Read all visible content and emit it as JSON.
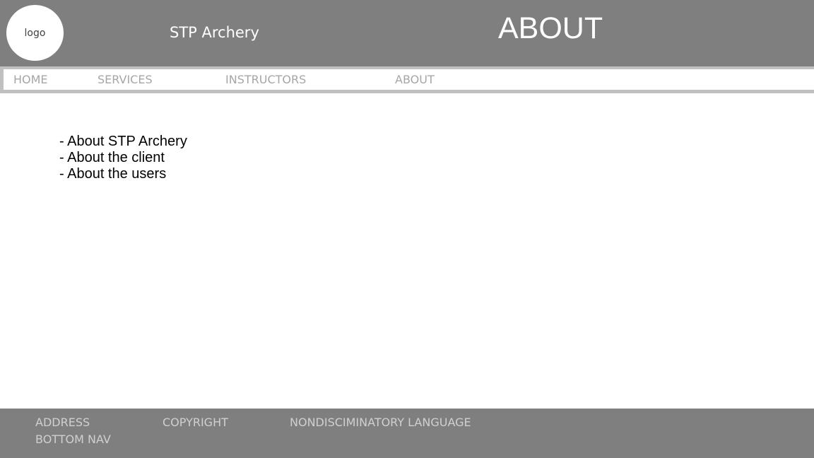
{
  "header": {
    "logo_label": "logo",
    "site_name": "STP Archery",
    "page_heading": "ABOUT"
  },
  "nav": {
    "items": [
      {
        "label": "HOME"
      },
      {
        "label": "SERVICES"
      },
      {
        "label": "INSTRUCTORS"
      },
      {
        "label": "ABOUT"
      }
    ]
  },
  "content": {
    "items": [
      {
        "label": "- About STP Archery"
      },
      {
        "label": "- About the client"
      },
      {
        "label": "- About the users"
      }
    ]
  },
  "footer": {
    "address": "ADDRESS",
    "copyright": "COPYRIGHT",
    "nondiscriminatory": "NONDISCIMINATORY LANGUAGE",
    "bottom_nav": "BOTTOM NAV"
  },
  "colors": {
    "header_bg": "#7f7f7f",
    "nav_border": "#c0c0c0",
    "nav_text": "#a6a6a6",
    "footer_text": "#d0d0d0"
  }
}
